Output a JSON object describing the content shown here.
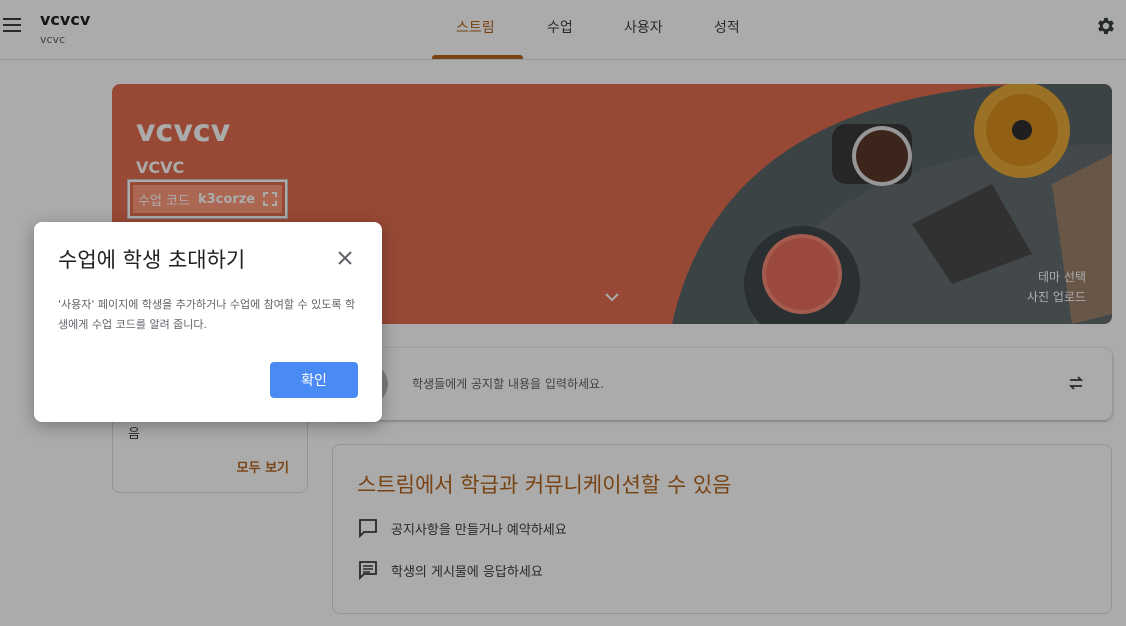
{
  "header": {
    "title": "vcvcv",
    "subtitle": "vcvc",
    "tabs": [
      {
        "label": "스트림",
        "active": true
      },
      {
        "label": "수업",
        "active": false
      },
      {
        "label": "사용자",
        "active": false
      },
      {
        "label": "성적",
        "active": false
      }
    ]
  },
  "banner": {
    "title": "vcvcv",
    "subtitle": "VCVC",
    "code_label": "수업 코드",
    "code_value": "k3corze",
    "theme_select": "테마 선택",
    "upload_photo": "사진 업로드",
    "color": "#e26e4f"
  },
  "upcoming": {
    "partial_text": "음",
    "see_all": "모두 보기"
  },
  "announce": {
    "placeholder": "학생들에게 공지할 내용을 입력하세요."
  },
  "info": {
    "title": "스트림에서 학급과 커뮤니케이션할 수 있음",
    "items": [
      {
        "icon": "announcement-icon",
        "text": "공지사항을 만들거나 예약하세요"
      },
      {
        "icon": "comment-icon",
        "text": "학생의 게시물에 응답하세요"
      }
    ]
  },
  "dialog": {
    "title": "수업에 학생 초대하기",
    "body": "'사용자' 페이지에 학생을 추가하거나 수업에 참여할 수 있도록 학생에게 수업 코드를 알려 줍니다.",
    "confirm": "확인"
  },
  "colors": {
    "accent": "#b5651d",
    "primary_button": "#4a8af4"
  }
}
